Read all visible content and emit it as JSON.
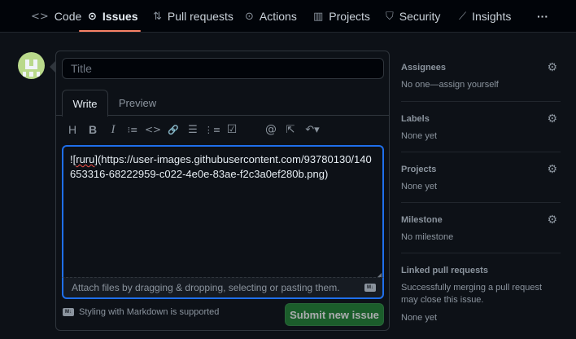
{
  "nav": {
    "tabs": [
      {
        "label": "Code",
        "icon": "code-icon",
        "glyph": "<>"
      },
      {
        "label": "Issues",
        "icon": "issue-opened-icon",
        "glyph": "⊙"
      },
      {
        "label": "Pull requests",
        "icon": "git-pull-request-icon",
        "glyph": "⇅"
      },
      {
        "label": "Actions",
        "icon": "play-icon",
        "glyph": "⊙"
      },
      {
        "label": "Projects",
        "icon": "table-icon",
        "glyph": "▥"
      },
      {
        "label": "Security",
        "icon": "shield-icon",
        "glyph": "⛉"
      },
      {
        "label": "Insights",
        "icon": "graph-icon",
        "glyph": "⟋"
      }
    ],
    "more": "···",
    "active_color": "#f78166"
  },
  "form": {
    "title_placeholder": "Title",
    "write_tab": "Write",
    "preview_tab": "Preview",
    "toolbar": [
      {
        "icon": "heading-icon",
        "glyph": "H"
      },
      {
        "icon": "bold-icon",
        "glyph": "B"
      },
      {
        "icon": "italic-icon",
        "glyph": "I"
      },
      {
        "icon": "quote-icon",
        "glyph": "⁝≡"
      },
      {
        "icon": "code-icon",
        "glyph": "<>"
      },
      {
        "icon": "link-icon",
        "glyph": "🔗"
      },
      {
        "icon": "unordered-list-icon",
        "glyph": "☰"
      },
      {
        "icon": "ordered-list-icon",
        "glyph": "⋮≡"
      },
      {
        "icon": "tasklist-icon",
        "glyph": "☑"
      },
      {
        "icon": "mention-icon",
        "glyph": "@"
      },
      {
        "icon": "cross-reference-icon",
        "glyph": "⇱"
      },
      {
        "icon": "reply-icon",
        "glyph": "↶▾"
      }
    ],
    "body_prefix": "![",
    "body_word": "ruru",
    "body_rest": "](https://user-images.githubusercontent.com/93780130/140653316-68222959-c022-4e0e-83ae-f2c3a0ef280b.png)",
    "attach_text": "Attach files by dragging & dropping, selecting or pasting them.",
    "markdown_badge": "M↓",
    "markdown_note": "Styling with Markdown is supported",
    "submit_label": "Submit new issue",
    "accent": "#238636"
  },
  "sidebar": {
    "sections": [
      {
        "heading": "Assignees",
        "value": "No one—assign yourself"
      },
      {
        "heading": "Labels",
        "value": "None yet"
      },
      {
        "heading": "Projects",
        "value": "None yet"
      },
      {
        "heading": "Milestone",
        "value": "No milestone"
      },
      {
        "heading": "Linked pull requests",
        "value": "Successfully merging a pull request may close this issue.",
        "extra": "None yet"
      }
    ],
    "gear_glyph": "⚙"
  }
}
